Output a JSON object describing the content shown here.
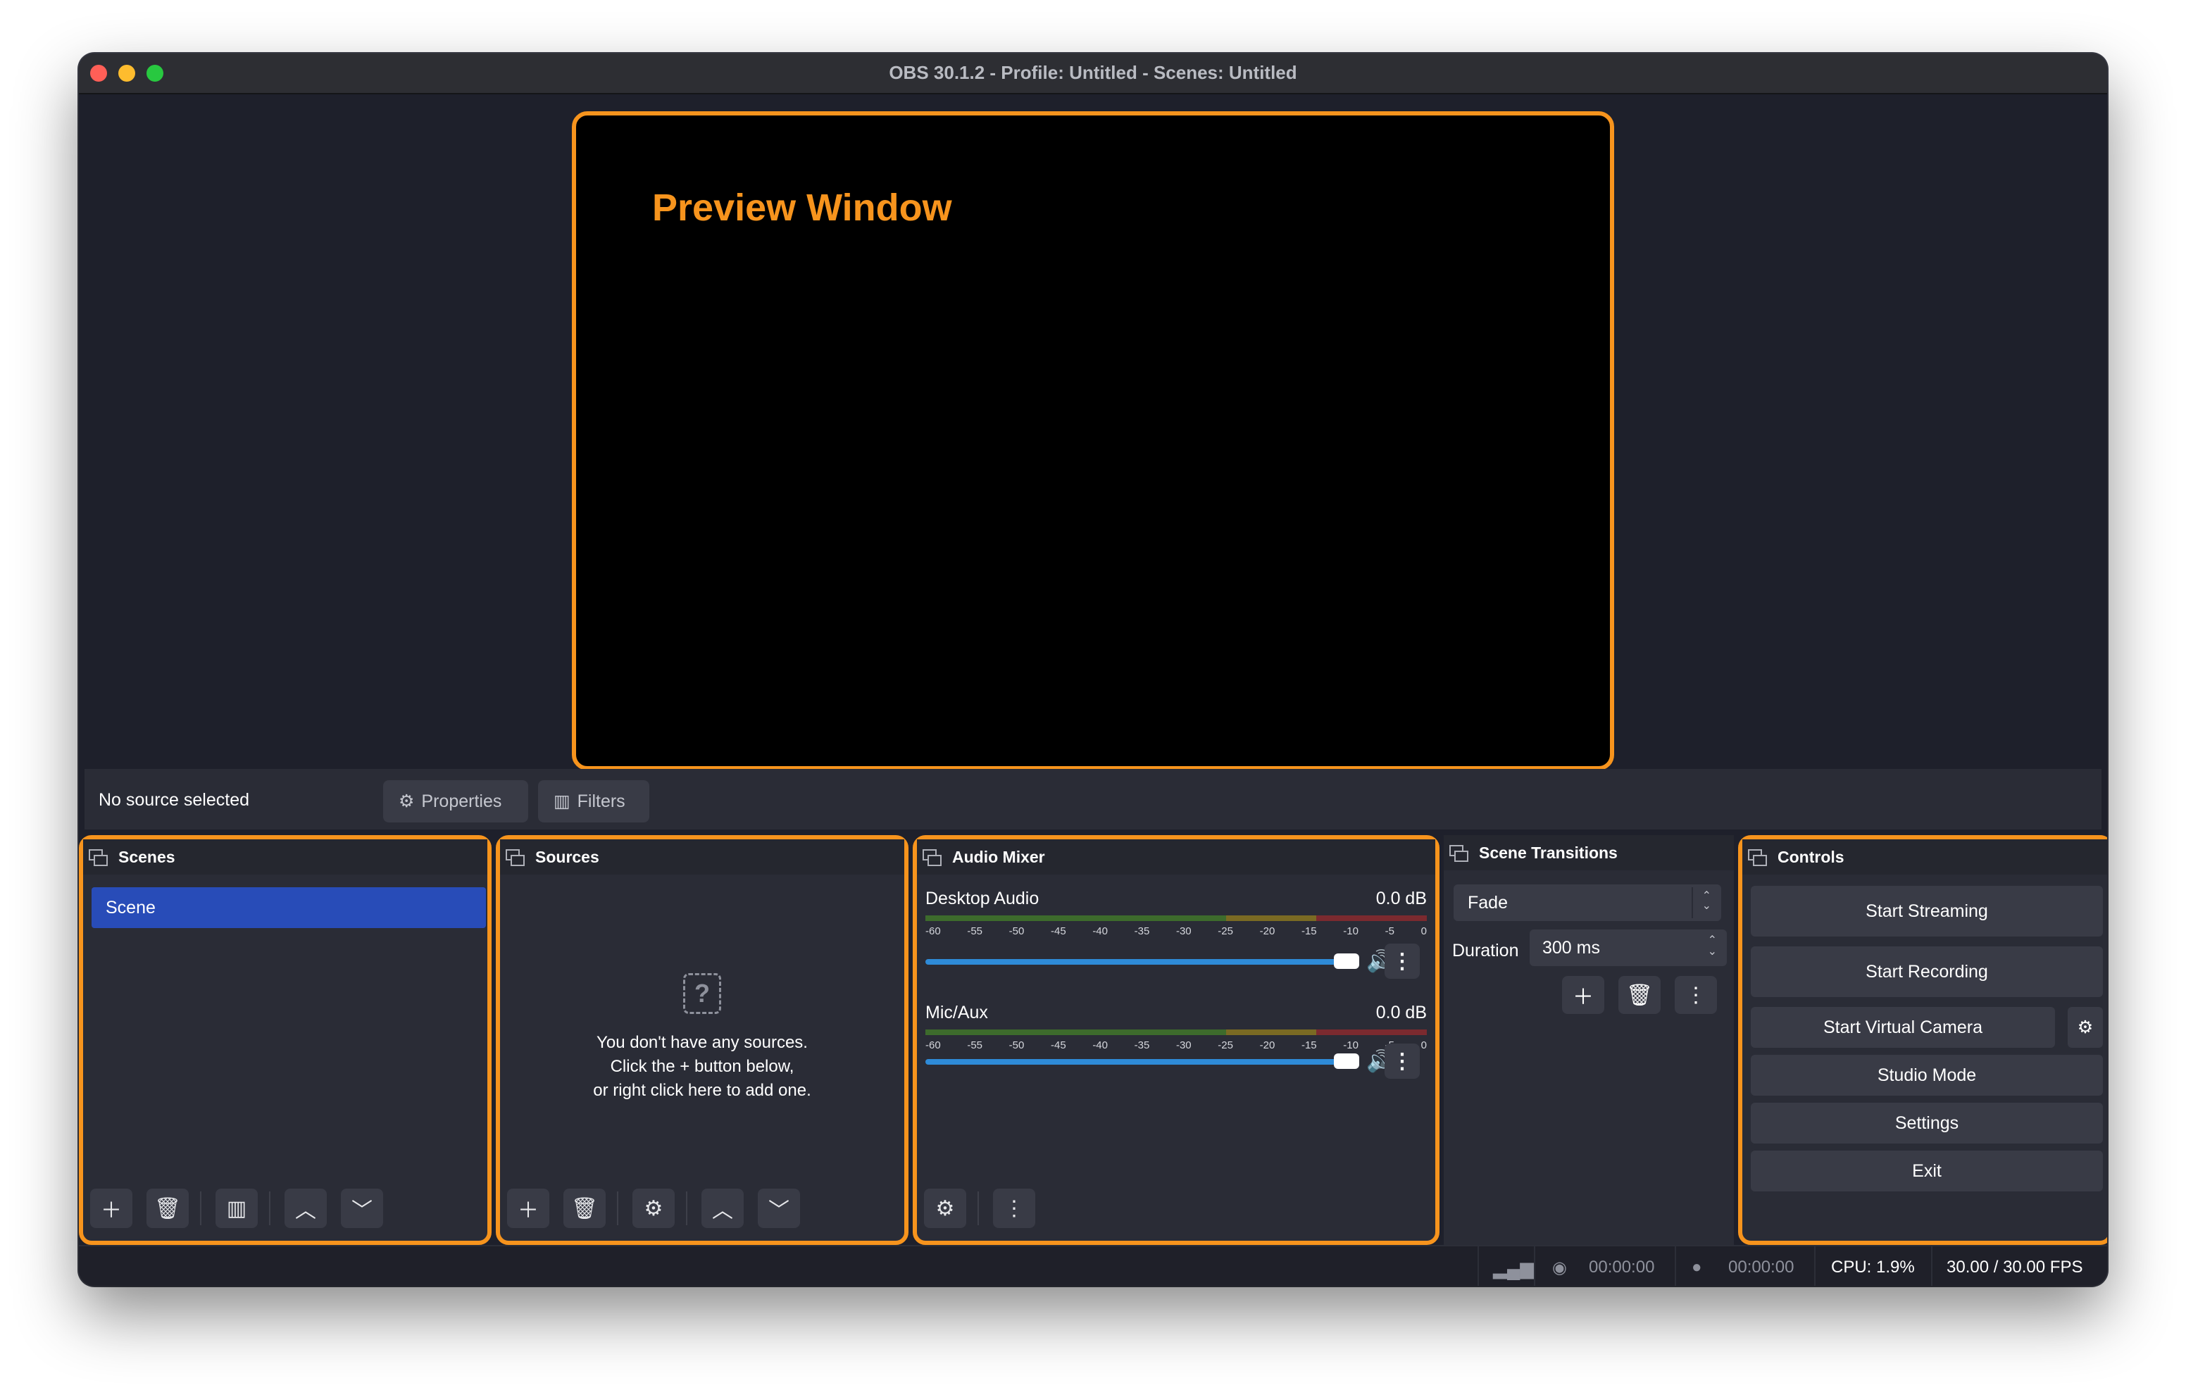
{
  "window": {
    "title": "OBS 30.1.2 - Profile: Untitled - Scenes: Untitled"
  },
  "preview": {
    "label": "Preview Window"
  },
  "context_bar": {
    "status": "No source selected",
    "properties_label": "Properties",
    "filters_label": "Filters"
  },
  "scenes": {
    "title": "Scenes",
    "items": [
      "Scene"
    ],
    "selected": "Scene"
  },
  "sources": {
    "title": "Sources",
    "empty_line1": "You don't have any sources.",
    "empty_line2": "Click the + button below,",
    "empty_line3": "or right click here to add one."
  },
  "audio_mixer": {
    "title": "Audio Mixer",
    "scale": [
      "-60",
      "-55",
      "-50",
      "-45",
      "-40",
      "-35",
      "-30",
      "-25",
      "-20",
      "-15",
      "-10",
      "-5",
      "0"
    ],
    "channels": [
      {
        "name": "Desktop Audio",
        "level": "0.0 dB",
        "volume": 0.97
      },
      {
        "name": "Mic/Aux",
        "level": "0.0 dB",
        "volume": 0.97
      }
    ]
  },
  "scene_transitions": {
    "title": "Scene Transitions",
    "transition": "Fade",
    "duration_label": "Duration",
    "duration": "300 ms"
  },
  "controls": {
    "title": "Controls",
    "start_streaming": "Start Streaming",
    "start_recording": "Start Recording",
    "start_virtual_camera": "Start Virtual Camera",
    "studio_mode": "Studio Mode",
    "settings": "Settings",
    "exit": "Exit"
  },
  "statusbar": {
    "stream_time": "00:00:00",
    "record_time": "00:00:00",
    "cpu": "CPU: 1.9%",
    "fps": "30.00 / 30.00 FPS"
  },
  "colors": {
    "highlight": "#f7941d",
    "selection": "#284cb8",
    "fader": "#2e8bd8"
  }
}
